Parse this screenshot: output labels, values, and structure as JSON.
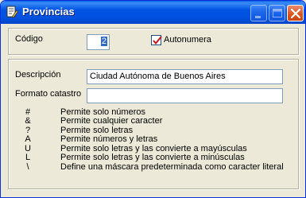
{
  "window": {
    "title": "Provincias",
    "icon": "edit-document-icon",
    "controls": {
      "minimize": "minimize-icon",
      "maximize": "maximize-icon",
      "close": "close-icon"
    }
  },
  "form": {
    "codigo_label": "Código",
    "codigo_value": "2",
    "autonumera_label": "Autonumera",
    "autonumera_checked": true,
    "descripcion_label": "Descripción",
    "descripcion_value": "Ciudad Autónoma de Buenos Aires",
    "formato_label": "Formato catastro",
    "formato_value": ""
  },
  "legend": [
    {
      "symbol": "#",
      "text": "Permite solo números"
    },
    {
      "symbol": "&",
      "text": "Permite cualquier caracter"
    },
    {
      "symbol": "?",
      "text": "Permite solo letras"
    },
    {
      "symbol": "A",
      "text": "Permite números y letras"
    },
    {
      "symbol": "U",
      "text": "Permite solo letras y las convierte a mayúsculas"
    },
    {
      "symbol": "L",
      "text": "Permite solo letras y las convierte a minúsculas"
    },
    {
      "symbol": "\\",
      "text": "Define una máscara predeterminada como caracter literal"
    }
  ]
}
